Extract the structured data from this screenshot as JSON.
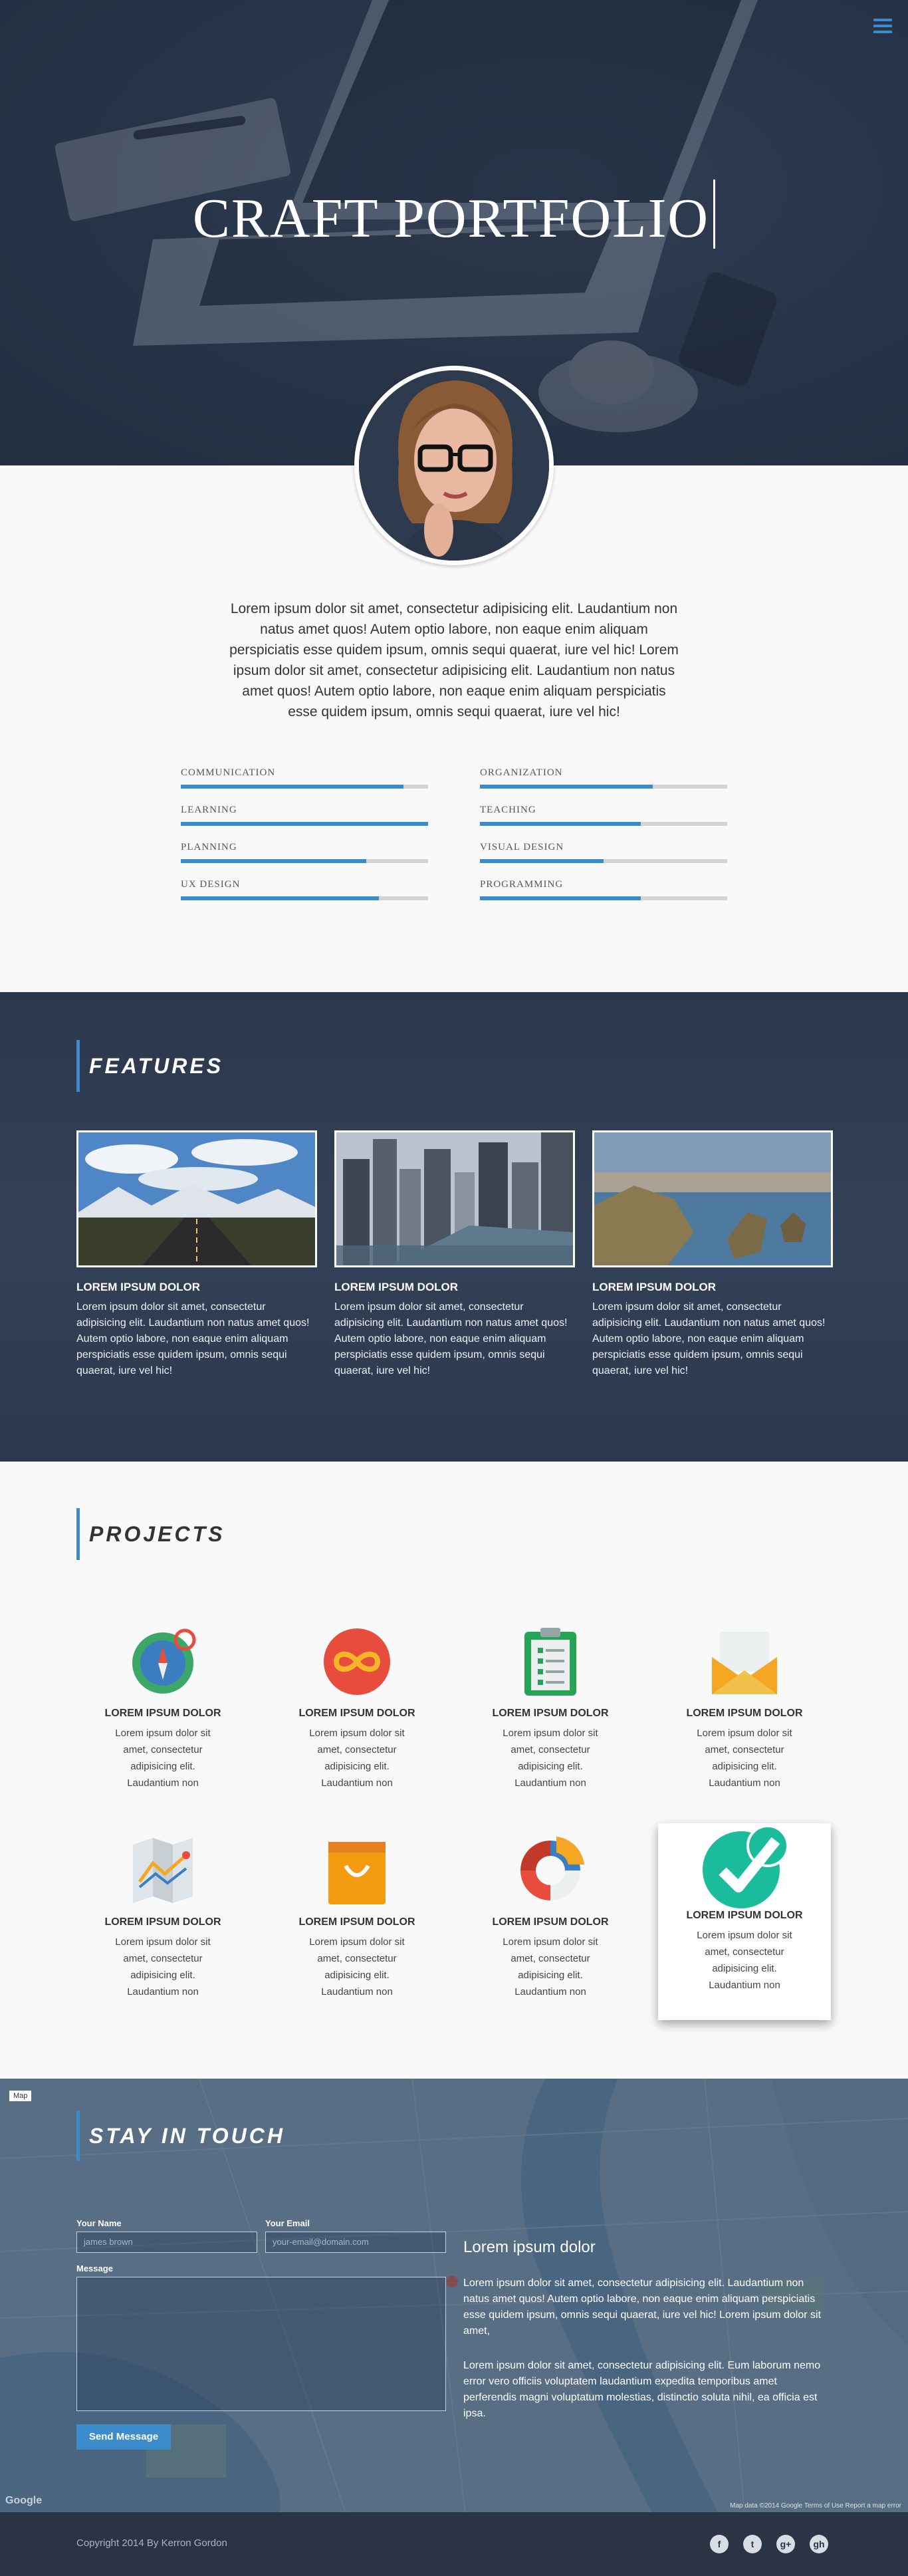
{
  "hero": {
    "title": "CRAFT PORTFOLIO"
  },
  "about": {
    "text": "Lorem ipsum dolor sit amet, consectetur adipisicing elit. Laudantium non natus amet quos! Autem optio labore, non eaque enim aliquam perspiciatis esse quidem ipsum, omnis sequi quaerat, iure vel hic! Lorem ipsum dolor sit amet, consectetur adipisicing elit. Laudantium non natus amet quos! Autem optio labore, non eaque enim aliquam perspiciatis esse quidem ipsum, omnis sequi quaerat, iure vel hic!",
    "skills": [
      {
        "name": "COMMUNICATION",
        "level": 0.9
      },
      {
        "name": "ORGANIZATION",
        "level": 0.7
      },
      {
        "name": "LEARNING",
        "level": 1.0
      },
      {
        "name": "TEACHING",
        "level": 0.65
      },
      {
        "name": "PLANNING",
        "level": 0.75
      },
      {
        "name": "VISUAL DESIGN",
        "level": 0.5
      },
      {
        "name": "UX DESIGN",
        "level": 0.8
      },
      {
        "name": "PROGRAMMING",
        "level": 0.65
      }
    ]
  },
  "features": {
    "heading": "FEATURES",
    "items": [
      {
        "title": "LOREM IPSUM DOLOR",
        "text": "Lorem ipsum dolor sit amet, consectetur adipisicing elit. Laudantium non natus amet quos! Autem optio labore, non eaque enim aliquam perspiciatis esse quidem ipsum, omnis sequi quaerat, iure vel hic!"
      },
      {
        "title": "LOREM IPSUM DOLOR",
        "text": "Lorem ipsum dolor sit amet, consectetur adipisicing elit. Laudantium non natus amet quos! Autem optio labore, non eaque enim aliquam perspiciatis esse quidem ipsum, omnis sequi quaerat, iure vel hic!"
      },
      {
        "title": "LOREM IPSUM DOLOR",
        "text": "Lorem ipsum dolor sit amet, consectetur adipisicing elit. Laudantium non natus amet quos! Autem optio labore, non eaque enim aliquam perspiciatis esse quidem ipsum, omnis sequi quaerat, iure vel hic!"
      }
    ]
  },
  "projects": {
    "heading": "PROJECTS",
    "items": [
      {
        "icon": "compass-icon",
        "title": "LOREM IPSUM DOLOR",
        "text": "Lorem ipsum dolor sit amet, consectetur adipisicing elit. Laudantium non"
      },
      {
        "icon": "infinity-icon",
        "title": "LOREM IPSUM DOLOR",
        "text": "Lorem ipsum dolor sit amet, consectetur adipisicing elit. Laudantium non"
      },
      {
        "icon": "clipboard-icon",
        "title": "LOREM IPSUM DOLOR",
        "text": "Lorem ipsum dolor sit amet, consectetur adipisicing elit. Laudantium non"
      },
      {
        "icon": "envelope-icon",
        "title": "LOREM IPSUM DOLOR",
        "text": "Lorem ipsum dolor sit amet, consectetur adipisicing elit. Laudantium non"
      },
      {
        "icon": "map-icon",
        "title": "LOREM IPSUM DOLOR",
        "text": "Lorem ipsum dolor sit amet, consectetur adipisicing elit. Laudantium non"
      },
      {
        "icon": "shopping-bag-icon",
        "title": "LOREM IPSUM DOLOR",
        "text": "Lorem ipsum dolor sit amet, consectetur adipisicing elit. Laudantium non"
      },
      {
        "icon": "pie-chart-icon",
        "title": "LOREM IPSUM DOLOR",
        "text": "Lorem ipsum dolor sit amet, consectetur adipisicing elit. Laudantium non"
      },
      {
        "icon": "checkmark-icon",
        "title": "LOREM IPSUM DOLOR",
        "text": "Lorem ipsum dolor sit amet, consectetur adipisicing elit. Laudantium non"
      }
    ]
  },
  "contact": {
    "heading": "STAY IN TOUCH",
    "map_label": "Map",
    "name_label": "Your Name",
    "name_placeholder": "james brown",
    "email_label": "Your Email",
    "email_placeholder": "your-email@domain.com",
    "message_label": "Message",
    "send_label": "Send Message",
    "info_title": "Lorem ipsum dolor",
    "info_p1": "Lorem ipsum dolor sit amet, consectetur adipisicing elit. Laudantium non natus amet quos! Autem optio labore, non eaque enim aliquam perspiciatis esse quidem ipsum, omnis sequi quaerat, iure vel hic! Lorem ipsum dolor sit amet,",
    "info_p2": "Lorem ipsum dolor sit amet, consectetur adipisicing elit. Eum laborum nemo error vero officiis voluptatem laudantium expedita temporibus amet perferendis magni voluptatum molestias, distinctio soluta nihil, ea officia est ipsa.",
    "google_label": "Google",
    "map_copyright": "Map data ©2014 Google   Terms of Use   Report a map error"
  },
  "footer": {
    "copyright": "Copyright 2014 By Kerron Gordon",
    "socials": [
      {
        "icon": "facebook-icon",
        "glyph": "f"
      },
      {
        "icon": "twitter-icon",
        "glyph": "t"
      },
      {
        "icon": "google-plus-icon",
        "glyph": "g+"
      },
      {
        "icon": "github-icon",
        "glyph": "gh"
      }
    ]
  },
  "colors": {
    "accent": "#3c8ccc",
    "dark": "#2a3445",
    "bar_track": "#d4d4d4"
  }
}
